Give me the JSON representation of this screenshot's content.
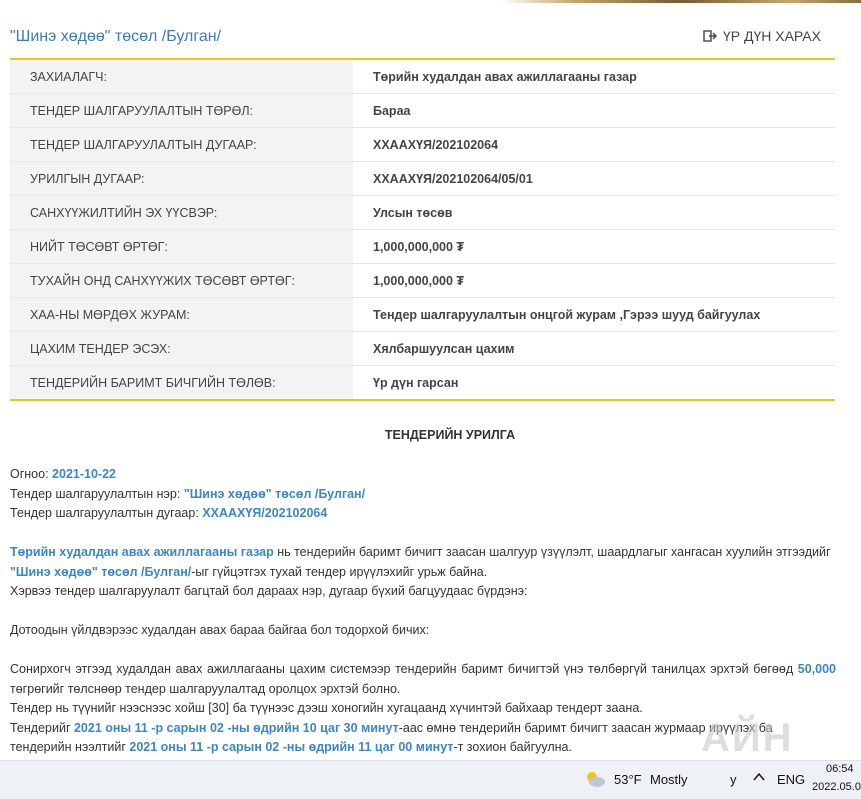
{
  "header": {
    "title": "\"Шинэ хөдөө\" төсөл /Булган/",
    "result_label": "ҮР ДҮН ХАРАХ"
  },
  "info_rows": [
    {
      "label": "ЗАХИАЛАГЧ:",
      "value": "Төрийн худалдан авах ажиллагааны газар"
    },
    {
      "label": "ТЕНДЕР ШАЛГАРУУЛАЛТЫН ТӨРӨЛ:",
      "value": "Бараа"
    },
    {
      "label": "ТЕНДЕР ШАЛГАРУУЛАЛТЫН ДУГААР:",
      "value": "ХХААХҮЯ/202102064"
    },
    {
      "label": "УРИЛГЫН ДУГААР:",
      "value": "ХХААХҮЯ/202102064/05/01"
    },
    {
      "label": "САНХҮҮЖИЛТИЙН ЭХ ҮҮСВЭР:",
      "value": "Улсын төсөв"
    },
    {
      "label": "НИЙТ ТӨСӨВТ ӨРТӨГ:",
      "value": "1,000,000,000 ₮"
    },
    {
      "label": "ТУХАЙН ОНД САНХҮҮЖИХ ТӨСӨВТ ӨРТӨГ:",
      "value": "1,000,000,000 ₮"
    },
    {
      "label": "ХАА-НЫ МӨРДӨХ ЖУРАМ:",
      "value": "Тендер шалгаруулалтын онцгой журам ,Гэрээ шууд байгуулах"
    },
    {
      "label": "ЦАХИМ ТЕНДЕР ЭСЭХ:",
      "value": "Хялбаршуулсан цахим"
    },
    {
      "label": "ТЕНДЕРИЙН БАРИМТ БИЧГИЙН ТӨЛӨВ:",
      "value": "Үр дүн гарсан"
    }
  ],
  "invitation": {
    "heading": "ТЕНДЕРИЙН УРИЛГА",
    "date_label": "Огноо: ",
    "date": "2021-10-22",
    "name_label": "Тендер шалгаруулалтын нэр: ",
    "name": "\"Шинэ хөдөө\" төсөл /Булган/",
    "number_label": "Тендер шалгаруулалтын дугаар: ",
    "number": "ХХААХҮЯ/202102064",
    "p1_org": "Төрийн худалдан авах ажиллагааны газар",
    "p1_mid": " нь тендерийн баримт бичигт заасан шалгуур үзүүлэлт, шаардлагыг хангасан хуулийн этгээдийг ",
    "p1_name": "\"Шинэ хөдөө\" төсөл /Булган/",
    "p1_end": "-ыг гүйцэтгэх тухай тендер ирүүлэхийг урьж байна.",
    "p2": "Хэрвээ тендер шалгаруулалт багцтай бол дараах нэр, дугаар бүхий багцуудаас бүрдэнэ:",
    "p3": "Дотоодын үйлдвэрээс худалдан авах бараа байгаа бол тодорхой бичих:",
    "p4_start": "Сонирхогч этгээд худалдан авах ажиллагааны цахим системээр тендерийн баримт бичигтэй үнэ төлбөргүй танилцах эрхтэй бөгөөд ",
    "p4_amount": "50,000",
    "p4_end": " төгрөгийг төлснөөр тендер шалгаруулалтад оролцох эрхтэй болно.",
    "p5": " Тендер нь түүнийг нээснээс хойш [30] ба түүнээс дээш хоногийн хугацаанд хүчинтэй байхаар тендерт заана.",
    "p6_start": " Тендерийг ",
    "p6_deadline": "2021 оны 11 -р сарын 02 -ны өдрийн 10 цаг 30 минут",
    "p6_mid": "-аас өмнө тендерийн баримт бичигт заасан журмаар ирүүлэх ба тендерийн нээлтийг ",
    "p6_open": "2021 оны 11 -р сарын 02 -ны өдрийн 11 цаг 00 минут",
    "p6_end": "-т зохион байгуулна."
  },
  "taskbar": {
    "temperature": "53°F",
    "weather": "Mostly",
    "weather_tail": "y",
    "language": "ENG",
    "time": "06:54",
    "date": "2022.05.0"
  },
  "watermark": "АЙН"
}
